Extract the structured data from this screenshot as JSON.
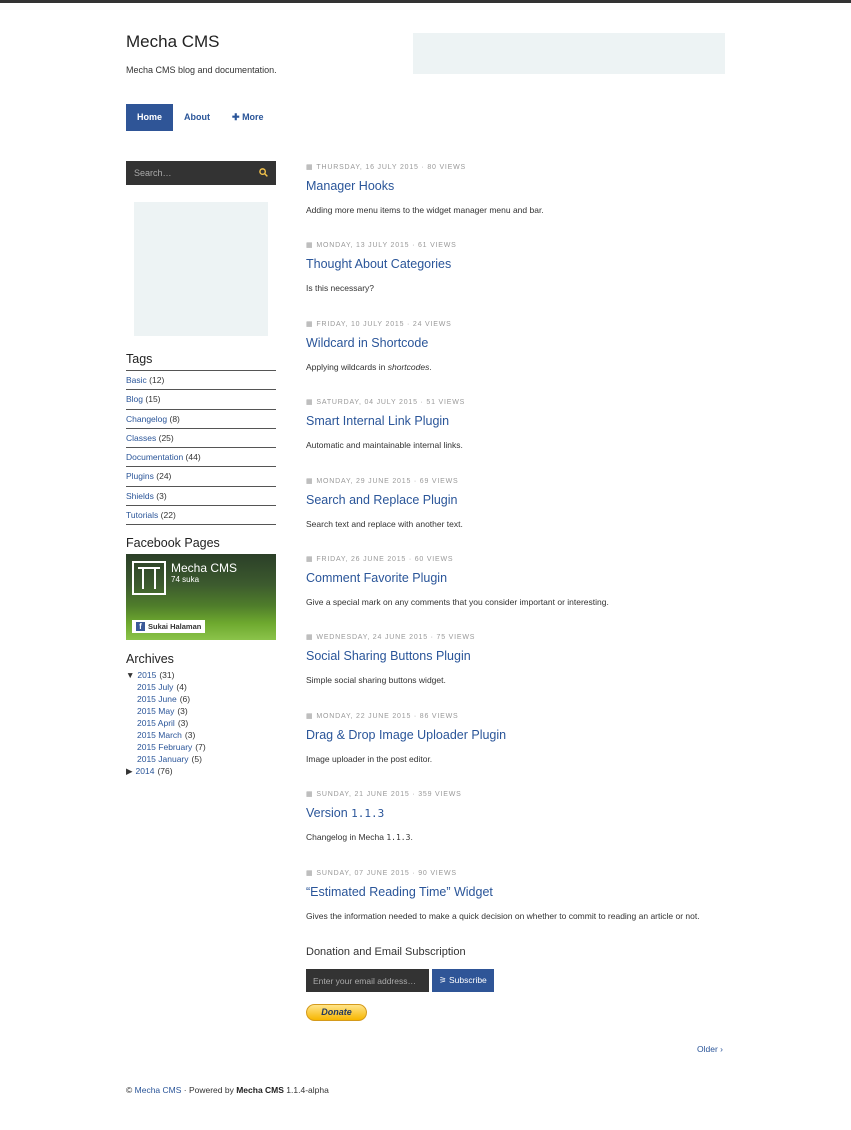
{
  "site": {
    "title": "Mecha CMS",
    "description": "Mecha CMS blog and documentation."
  },
  "nav": [
    {
      "label": "Home",
      "active": true
    },
    {
      "label": "About",
      "active": false
    },
    {
      "label": "More",
      "icon": "plus-icon",
      "active": false
    }
  ],
  "search": {
    "placeholder": "Search…",
    "icon": "search-icon"
  },
  "tags": {
    "title": "Tags",
    "items": [
      {
        "label": "Basic",
        "count": "(12)"
      },
      {
        "label": "Blog",
        "count": "(15)"
      },
      {
        "label": "Changelog",
        "count": "(8)"
      },
      {
        "label": "Classes",
        "count": "(25)"
      },
      {
        "label": "Documentation",
        "count": "(44)"
      },
      {
        "label": "Plugins",
        "count": "(24)"
      },
      {
        "label": "Shields",
        "count": "(3)"
      },
      {
        "label": "Tutorials",
        "count": "(22)"
      }
    ]
  },
  "facebook": {
    "title": "Facebook Pages",
    "page_name": "Mecha CMS",
    "likes": "74 suka",
    "button": "Sukai Halaman"
  },
  "archives": {
    "title": "Archives",
    "years": [
      {
        "toggle": "▼",
        "label": "2015",
        "count": "(31)",
        "months": [
          {
            "label": "2015 July",
            "count": "(4)"
          },
          {
            "label": "2015 June",
            "count": "(6)"
          },
          {
            "label": "2015 May",
            "count": "(3)"
          },
          {
            "label": "2015 April",
            "count": "(3)"
          },
          {
            "label": "2015 March",
            "count": "(3)"
          },
          {
            "label": "2015 February",
            "count": "(7)"
          },
          {
            "label": "2015 January",
            "count": "(5)"
          }
        ]
      },
      {
        "toggle": "▶",
        "label": "2014",
        "count": "(76)",
        "months": []
      }
    ]
  },
  "posts": [
    {
      "meta": "Thursday, 16 July 2015 · 80 Views",
      "title": "Manager Hooks",
      "excerpt": "Adding more menu items to the widget manager menu and bar."
    },
    {
      "meta": "Monday, 13 July 2015 · 61 Views",
      "title": "Thought About Categories",
      "excerpt": "Is this necessary?"
    },
    {
      "meta": "Friday, 10 July 2015 · 24 Views",
      "title": "Wildcard in Shortcode",
      "excerpt_pre": "Applying wildcards in ",
      "excerpt_em": "shortcodes",
      "excerpt_post": "."
    },
    {
      "meta": "Saturday, 04 July 2015 · 51 Views",
      "title": "Smart Internal Link Plugin",
      "excerpt": "Automatic and maintainable internal links."
    },
    {
      "meta": "Monday, 29 June 2015 · 69 Views",
      "title": "Search and Replace Plugin",
      "excerpt": "Search text and replace with another text."
    },
    {
      "meta": "Friday, 26 June 2015 · 60 Views",
      "title": "Comment Favorite Plugin",
      "excerpt": "Give a special mark on any comments that you consider important or interesting."
    },
    {
      "meta": "Wednesday, 24 June 2015 · 75 Views",
      "title": "Social Sharing Buttons Plugin",
      "excerpt": "Simple social sharing buttons widget."
    },
    {
      "meta": "Monday, 22 June 2015 · 86 Views",
      "title": "Drag & Drop Image Uploader Plugin",
      "excerpt": "Image uploader in the post editor."
    },
    {
      "meta": "Sunday, 21 June 2015 · 359 Views",
      "title_pre": "Version ",
      "title_code": "1.1.3",
      "excerpt_pre": "Changelog in Mecha ",
      "excerpt_code": "1.1.3",
      "excerpt_post": "."
    },
    {
      "meta": "Sunday, 07 June 2015 · 90 Views",
      "title": "“Estimated Reading Time” Widget",
      "excerpt": "Gives the information needed to make a quick decision on whether to commit to reading an article or not."
    }
  ],
  "donation": {
    "title": "Donation and Email Subscription",
    "email_placeholder": "Enter your email address…",
    "subscribe": "Subscribe",
    "subscribe_icon": "rss-icon",
    "donate": "Donate"
  },
  "pagination": {
    "older": "Older ›"
  },
  "footer": {
    "copyright": "©",
    "site_link": "Mecha CMS",
    "powered": " · Powered by ",
    "engine": "Mecha CMS",
    "version": " 1.1.4-alpha"
  }
}
